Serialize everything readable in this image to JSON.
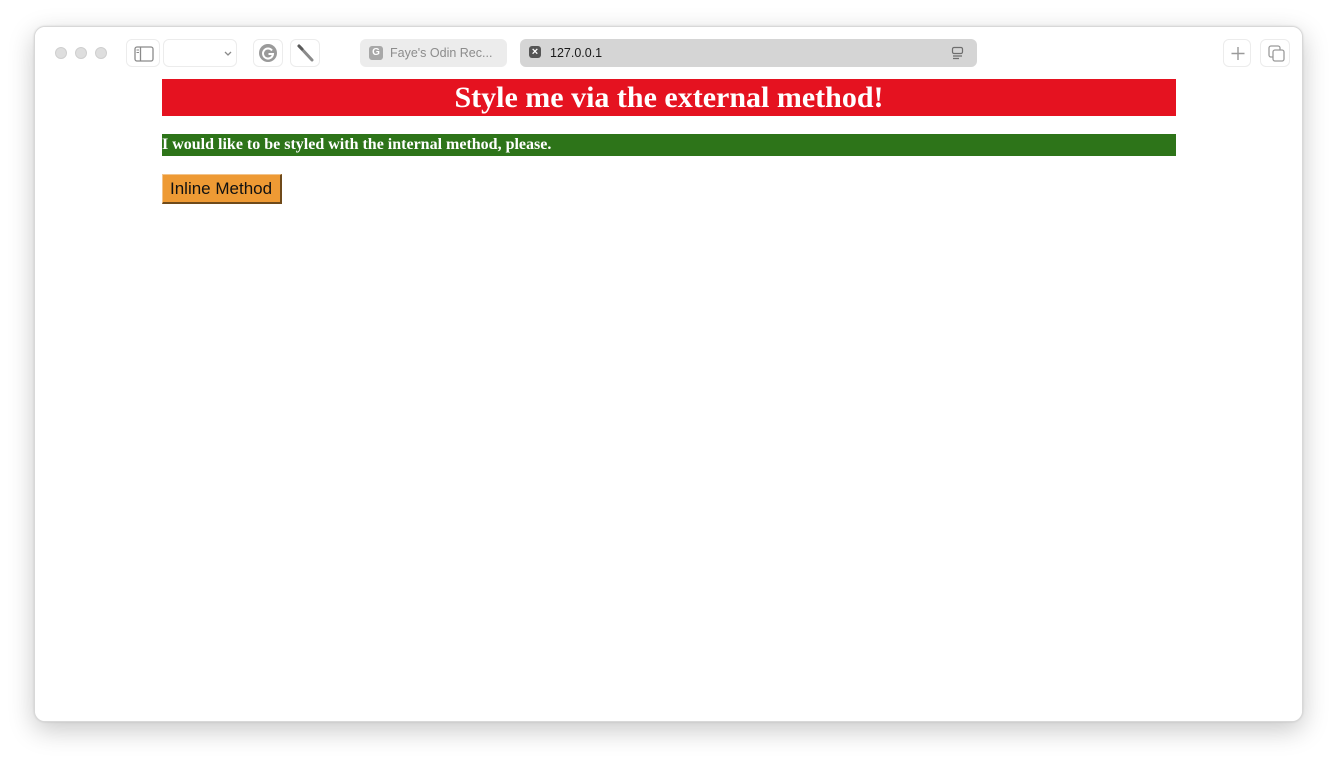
{
  "browser": {
    "tabs": [
      {
        "label": "Faye's Odin Rec...",
        "favicon_letter": "G",
        "active": false
      },
      {
        "label": "127.0.0.1",
        "favicon_letter": "×",
        "active": true
      }
    ],
    "icons": {
      "sidebar": "sidebar-icon",
      "grammarly": "grammarly-icon",
      "pen": "pen-icon",
      "reader": "reader-icon",
      "new_tab": "plus-icon",
      "tab_overview": "tab-overview-icon"
    }
  },
  "page": {
    "heading": "Style me via the external method!",
    "paragraph": "I would like to be styled with the internal method, please.",
    "button_label": "Inline Method"
  },
  "colors": {
    "heading_bg": "#e51220",
    "paragraph_bg": "#2d7419",
    "button_bg": "#ee9a34"
  }
}
